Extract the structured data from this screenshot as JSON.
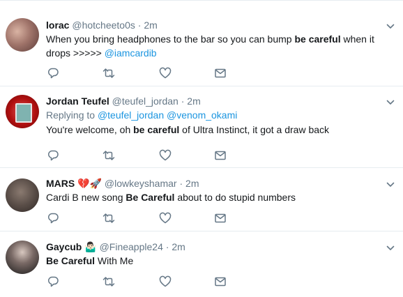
{
  "colors": {
    "text": "#14171a",
    "muted": "#657786",
    "link": "#1b95e0",
    "icon": "#657786",
    "divider": "#e6ecf0"
  },
  "tweets": [
    {
      "name": "lorac",
      "name_emoji": "",
      "handle": "@hotcheeto0s",
      "dot": "·",
      "time": "2m",
      "reply_to": null,
      "text_parts": {
        "a": "When you bring headphones to the bar so you can bump ",
        "b": "be careful",
        "c": " when it drops >>>>> ",
        "link": "@iamcardib"
      }
    },
    {
      "name": "Jordan Teufel",
      "name_emoji": "",
      "handle": "@teufel_jordan",
      "dot": "·",
      "time": "2m",
      "reply_to": {
        "label": "Replying to ",
        "user1": "@teufel_jordan",
        "user2": "@venom_okami"
      },
      "text_parts": {
        "a": "You're welcome, oh ",
        "b": "be careful",
        "c": " of Ultra Instinct, it got a draw back",
        "link": ""
      }
    },
    {
      "name": "MARS",
      "name_emoji": "💔🚀",
      "handle": "@lowkeyshamar",
      "dot": "·",
      "time": "2m",
      "reply_to": null,
      "text_parts": {
        "a": "Cardi B new song ",
        "b": "Be Careful",
        "c": " about to do stupid numbers",
        "link": ""
      }
    },
    {
      "name": "Gaycub",
      "name_emoji": "🤷🏻‍♂️",
      "handle": "@Fineapple24",
      "dot": "·",
      "time": "2m",
      "reply_to": null,
      "text_parts": {
        "a": "",
        "b": "Be Careful",
        "c": " With Me",
        "link": ""
      }
    }
  ],
  "icons": {
    "reply": "reply-icon",
    "retweet": "retweet-icon",
    "like": "heart-icon",
    "dm": "envelope-icon",
    "caret": "chevron-down-icon"
  }
}
